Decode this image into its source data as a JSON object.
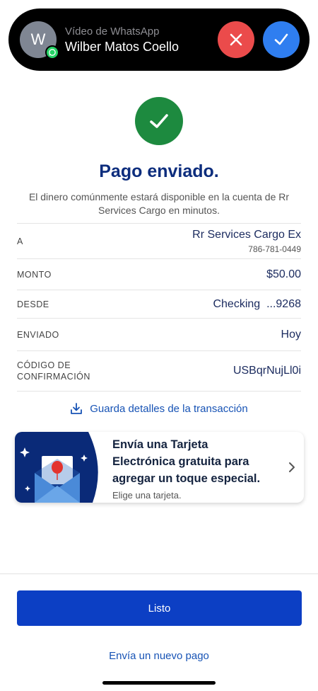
{
  "call_banner": {
    "avatar_letter": "W",
    "subtitle": "Vídeo de WhatsApp",
    "caller_name": "Wilber Matos Coello"
  },
  "header": {
    "title": "Pago enviado.",
    "subtitle": "El dinero comúnmente estará disponible en la cuenta de Rr Services Cargo en minutos."
  },
  "details": {
    "to_label": "A",
    "to_value": "Rr Services Cargo Ex",
    "to_phone": "786-781-0449",
    "amount_label": "MONTO",
    "amount_value": "$50.00",
    "from_label": "DESDE",
    "from_value": "Checking  ...9268",
    "sent_label": "ENVIADO",
    "sent_value": "Hoy",
    "confirmation_label": "CÓDIGO DE CONFIRMACIÓN",
    "confirmation_value": "USBqrNujLl0i"
  },
  "save_link": "Guarda detalles de la transacción",
  "promo": {
    "headline": "Envía una Tarjeta Electrónica gratuita para agregar un toque especial.",
    "sub": "Elige una tarjeta."
  },
  "actions": {
    "done_label": "Listo",
    "new_payment_label": "Envía un nuevo pago"
  },
  "colors": {
    "brand_blue": "#0c3fc4",
    "title_navy": "#0d2d7d",
    "success_green": "#1d8a3f",
    "decline_red": "#eb4b4b",
    "accept_blue": "#2f7ef0"
  }
}
